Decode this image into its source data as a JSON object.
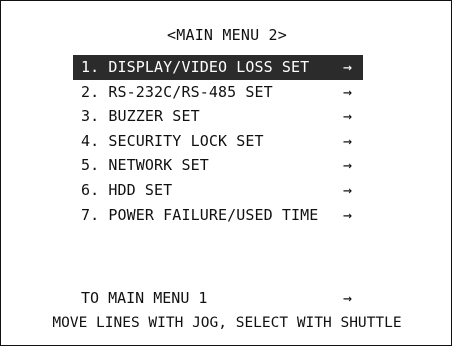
{
  "menu": {
    "title": "<MAIN MENU 2>",
    "arrow_glyph": "→",
    "items": [
      {
        "label": "1. DISPLAY/VIDEO LOSS SET",
        "selected": true
      },
      {
        "label": "2. RS-232C/RS-485 SET",
        "selected": false
      },
      {
        "label": "3. BUZZER SET",
        "selected": false
      },
      {
        "label": "4. SECURITY LOCK SET",
        "selected": false
      },
      {
        "label": "5. NETWORK SET",
        "selected": false
      },
      {
        "label": "6. HDD SET",
        "selected": false
      },
      {
        "label": "7. POWER FAILURE/USED TIME",
        "selected": false
      }
    ],
    "back_item": {
      "label": "TO MAIN MENU 1"
    },
    "help_text": "MOVE LINES WITH JOG, SELECT WITH SHUTTLE"
  },
  "colors": {
    "background": "#ffffff",
    "text": "#111111",
    "highlight_bg": "#2b2b2b",
    "highlight_text": "#ffffff"
  }
}
